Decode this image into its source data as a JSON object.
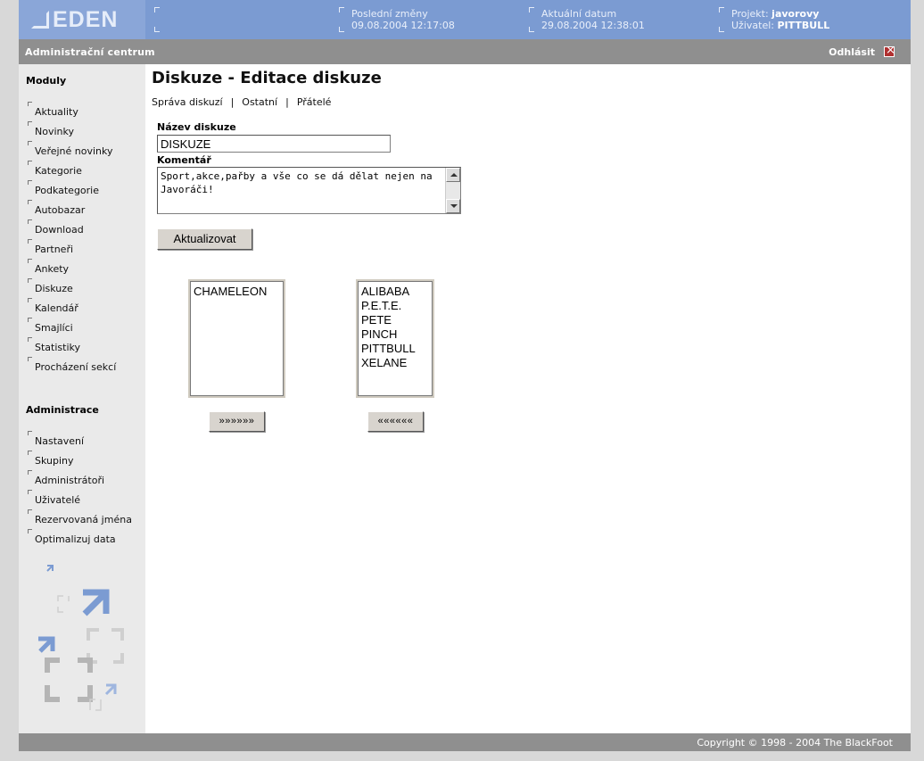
{
  "header": {
    "logo_text": "EDEN",
    "last_changes_label": "Poslední změny",
    "last_changes_value": "09.08.2004 12:17:08",
    "current_date_label": "Aktuální datum",
    "current_date_value": "29.08.2004 12:38:01",
    "project_label": "Projekt:",
    "project_value": "javorovy",
    "user_label": "Uživatel:",
    "user_value": "PITTBULL"
  },
  "admin_bar": {
    "title": "Administrační centrum",
    "logout_label": "Odhlásit",
    "logout_icon": "logout-icon"
  },
  "sidebar": {
    "modules_heading": "Moduly",
    "modules": [
      "Aktuality",
      "Novinky",
      "Veřejné novinky",
      "Kategorie",
      "Podkategorie",
      "Autobazar",
      "Download",
      "Partneři",
      "Ankety",
      "Diskuze",
      "Kalendář",
      "Smajlíci",
      "Statistiky",
      "Procházení sekcí"
    ],
    "admin_heading": "Administrace",
    "admin_items": [
      "Nastavení",
      "Skupiny",
      "Administrátoři",
      "Uživatelé",
      "Rezervovaná jména",
      "Optimalizuj data"
    ]
  },
  "main": {
    "title": "Diskuze - Editace diskuze",
    "subnav": [
      "Správa diskuzí",
      "Ostatní",
      "Přátelé"
    ],
    "subnav_separator": "|",
    "name_label": "Název diskuze",
    "name_value": "DISKUZE",
    "comment_label": "Komentář",
    "comment_value": "Sport,akce,pařby a vše co se dá dělat nejen na Javoráči!",
    "update_button": "Aktualizovat",
    "left_list": [
      "CHAMELEON"
    ],
    "right_list": [
      "ALIBABA",
      "P.E.T.E.",
      "PETE",
      "PINCH",
      "PITTBULL",
      "XELANE"
    ],
    "move_right_button": "»»»»»»",
    "move_left_button": "««««««"
  },
  "footer": {
    "copyright": "Copyright © 1998 - 2004 The BlackFoot"
  },
  "colors": {
    "header_bg": "#7b9bd2",
    "bar_bg": "#8f8f8f",
    "sidebar_bg": "#eaeaea"
  }
}
